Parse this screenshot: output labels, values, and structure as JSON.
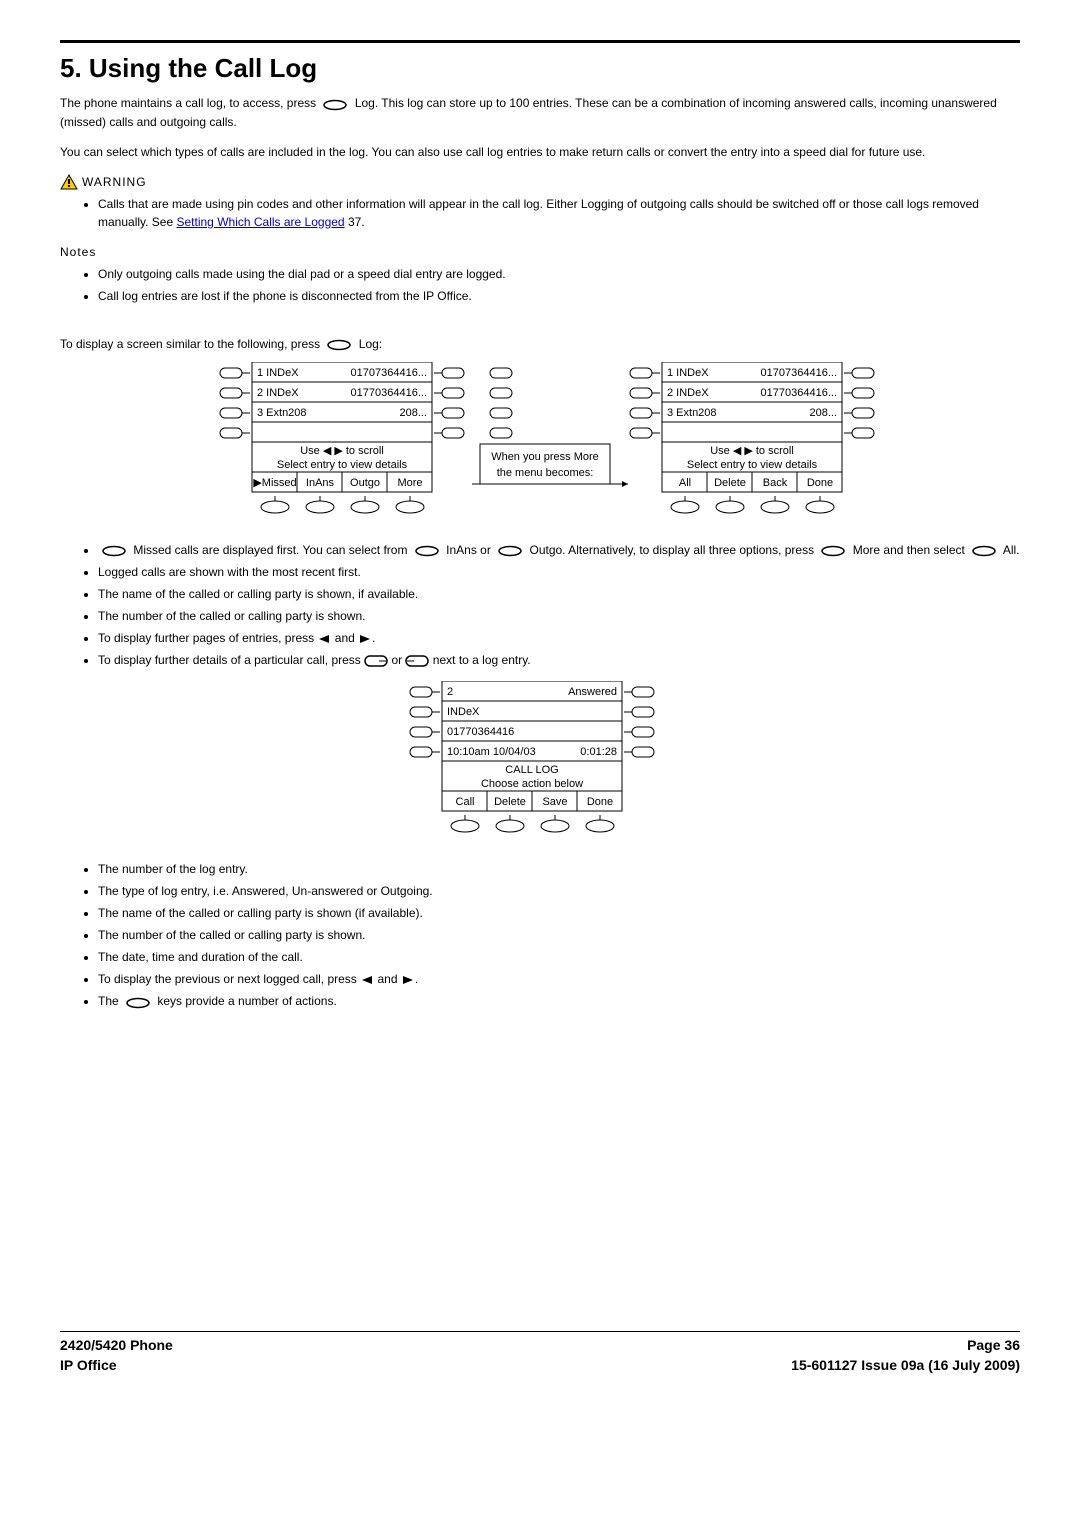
{
  "heading": "5. Using the Call Log",
  "p1_pre": "The phone maintains a call log, to access, press ",
  "p1_mid": " Log. This log can store up to 100 entries. These can be a combination of incoming answered calls, incoming unanswered (missed) calls and outgoing calls.",
  "p2": "You can select which types of calls are included in the log. You can also use call log entries to make return calls or convert the entry into a speed dial for future use.",
  "warning_label": "WARNING",
  "warning_item_pre": "Calls that are made using pin codes and other information will appear in the call log. Either Logging of outgoing calls should be switched off or those call logs removed manually. See ",
  "warning_link": "Setting Which Calls are Logged",
  "page_ref": "37",
  "notes_label": "Notes",
  "notes": [
    "Only outgoing calls made using the dial pad or a speed dial entry are logged.",
    "Call log entries are lost if the phone is disconnected from the IP Office."
  ],
  "p3_pre": "To display a screen similar to the following, press ",
  "p3_post": " Log:",
  "fig1": {
    "scroll_hint": "Use ◀ ▶ to scroll",
    "select_hint": "Select entry to view details",
    "left_softkeys": [
      "▶Missed",
      "InAns",
      "Outgo",
      "More"
    ],
    "right_softkeys": [
      "All",
      "Delete",
      "Back",
      "Done"
    ],
    "rows": [
      {
        "l": "1  INDeX",
        "r": "01707364416..."
      },
      {
        "l": "2  INDeX",
        "r": "01770364416..."
      },
      {
        "l": "3  Extn208",
        "r": "208..."
      }
    ],
    "mid_top": "When you press More",
    "mid_bot": "the menu becomes:"
  },
  "bullets_after_fig1": {
    "b1_a": " Missed calls are displayed first. You can select from ",
    "b1_b": " InAns or ",
    "b1_c": " Outgo. Alternatively, to display all three options, press ",
    "b1_d": " More and then select ",
    "b1_e": " All.",
    "b2": "Logged calls are shown with the most recent first.",
    "b3": "The name of the called or calling party is shown, if available.",
    "b4": "The number of the called or calling party is shown.",
    "b5_a": "To display further pages of entries, press ",
    "b5_b": " and ",
    "b5_c": ".",
    "b6_a": "To display further details of a particular call, press ",
    "b6_b": " or ",
    "b6_c": " next to a log entry."
  },
  "fig2": {
    "rows": [
      {
        "l": "2",
        "r": "Answered"
      },
      {
        "l": "INDeX",
        "r": ""
      },
      {
        "l": "01770364416",
        "r": ""
      },
      {
        "l": "10:10am  10/04/03",
        "r": "0:01:28"
      }
    ],
    "title": "CALL LOG",
    "subtitle": "Choose action below",
    "softkeys": [
      "Call",
      "Delete",
      "Save",
      "Done"
    ]
  },
  "bullets_after_fig2": {
    "b1": "The number of the log entry.",
    "b2": "The type of log entry, i.e. Answered, Un-answered or Outgoing.",
    "b3": "The name of the called or calling party is shown (if available).",
    "b4": "The number of the called or calling party is shown.",
    "b5": "The date, time and duration of the call.",
    "b6_a": "To display the previous or next logged call, press ",
    "b6_b": " and ",
    "b6_c": ".",
    "b7_a": "The ",
    "b7_b": " keys provide a number of actions."
  },
  "footer": {
    "left1": "2420/5420 Phone",
    "left2": "IP Office",
    "right1": "Page 36",
    "right2": "15-601127 Issue 09a (16 July 2009)"
  }
}
